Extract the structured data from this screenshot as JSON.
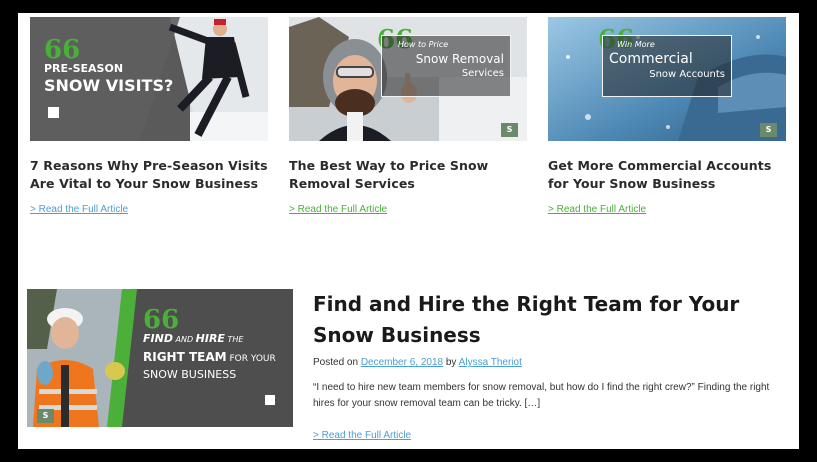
{
  "articles": [
    {
      "thumb_quote": "66",
      "thumb_line1": "PRE-SEASON",
      "thumb_line2": "SNOW VISITS?",
      "title": "7 Reasons Why Pre-Season Visits Are Vital to Your Snow Business",
      "link": "> Read the Full Article"
    },
    {
      "thumb_quote": "66",
      "thumb_line1": "How to Price",
      "thumb_line2": "Snow Removal",
      "thumb_line3": "Services",
      "badge": "S",
      "title": "The Best Way to Price Snow Removal Services",
      "link": "> Read the Full Article"
    },
    {
      "thumb_quote": "66",
      "thumb_line1": "Win More",
      "thumb_line2": "Commercial",
      "thumb_line3": "Snow Accounts",
      "badge": "S",
      "title": "Get More Commercial Accounts for Your Snow Business",
      "link": "> Read the Full Article"
    }
  ],
  "featured": {
    "thumb_quote": "66",
    "thumb_line1_a": "FIND",
    "thumb_line1_b": " AND ",
    "thumb_line1_c": "HIRE",
    "thumb_line1_d": " THE",
    "thumb_line2_a": "RIGHT TEAM",
    "thumb_line2_b": " FOR YOUR",
    "thumb_line3": "SNOW BUSINESS",
    "badge": "S",
    "title": "Find and Hire the Right Team for Your Snow Business",
    "posted_on": "Posted on ",
    "date": "December 6, 2018",
    "by": " by ",
    "author": "Alyssa Theriot",
    "excerpt": "“I need to hire new team members for snow removal, but how do I find the right crew?” Finding the right hires for your snow removal team can be tricky. […]",
    "link": "> Read the Full Article"
  },
  "colors": {
    "accent_green": "#4caf3a",
    "link_blue": "#4a9fd4"
  }
}
